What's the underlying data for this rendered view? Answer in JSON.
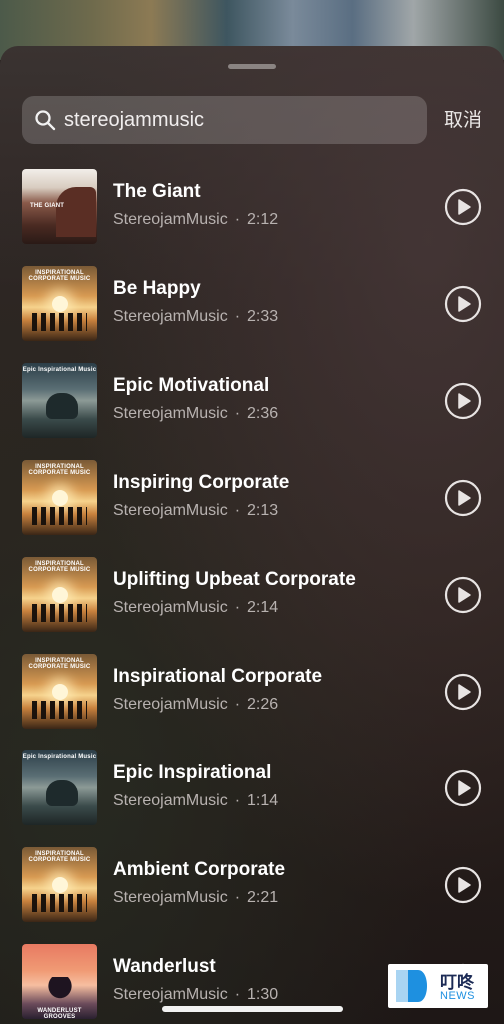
{
  "search": {
    "value": "stereojammusic",
    "cancel_label": "取消"
  },
  "tracks": [
    {
      "title": "The Giant",
      "artist": "StereojamMusic",
      "duration": "2:12",
      "cover": "giant",
      "cover_caption": "THE GIANT"
    },
    {
      "title": "Be Happy",
      "artist": "StereojamMusic",
      "duration": "2:33",
      "cover": "corporate",
      "cover_caption": "INSPIRATIONAL CORPORATE MUSIC"
    },
    {
      "title": "Epic Motivational",
      "artist": "StereojamMusic",
      "duration": "2:36",
      "cover": "elephant",
      "cover_caption": "Epic Inspirational Music"
    },
    {
      "title": "Inspiring Corporate",
      "artist": "StereojamMusic",
      "duration": "2:13",
      "cover": "corporate",
      "cover_caption": "INSPIRATIONAL CORPORATE MUSIC"
    },
    {
      "title": "Uplifting Upbeat Corporate",
      "artist": "StereojamMusic",
      "duration": "2:14",
      "cover": "corporate",
      "cover_caption": "INSPIRATIONAL CORPORATE MUSIC"
    },
    {
      "title": "Inspirational Corporate",
      "artist": "StereojamMusic",
      "duration": "2:26",
      "cover": "corporate",
      "cover_caption": "INSPIRATIONAL CORPORATE MUSIC"
    },
    {
      "title": "Epic Inspirational",
      "artist": "StereojamMusic",
      "duration": "1:14",
      "cover": "elephant",
      "cover_caption": "Epic Inspirational Music"
    },
    {
      "title": "Ambient Corporate",
      "artist": "StereojamMusic",
      "duration": "2:21",
      "cover": "corporate",
      "cover_caption": "INSPIRATIONAL CORPORATE MUSIC"
    },
    {
      "title": "Wanderlust",
      "artist": "StereojamMusic",
      "duration": "1:30",
      "cover": "wanderlust",
      "cover_caption": "WANDERLUST GROOVES"
    }
  ],
  "meta_separator": "·",
  "icons": {
    "search": "search-icon",
    "play": "play-circle-icon"
  },
  "watermark": {
    "chinese": "叮咚",
    "english": "NEWS"
  }
}
